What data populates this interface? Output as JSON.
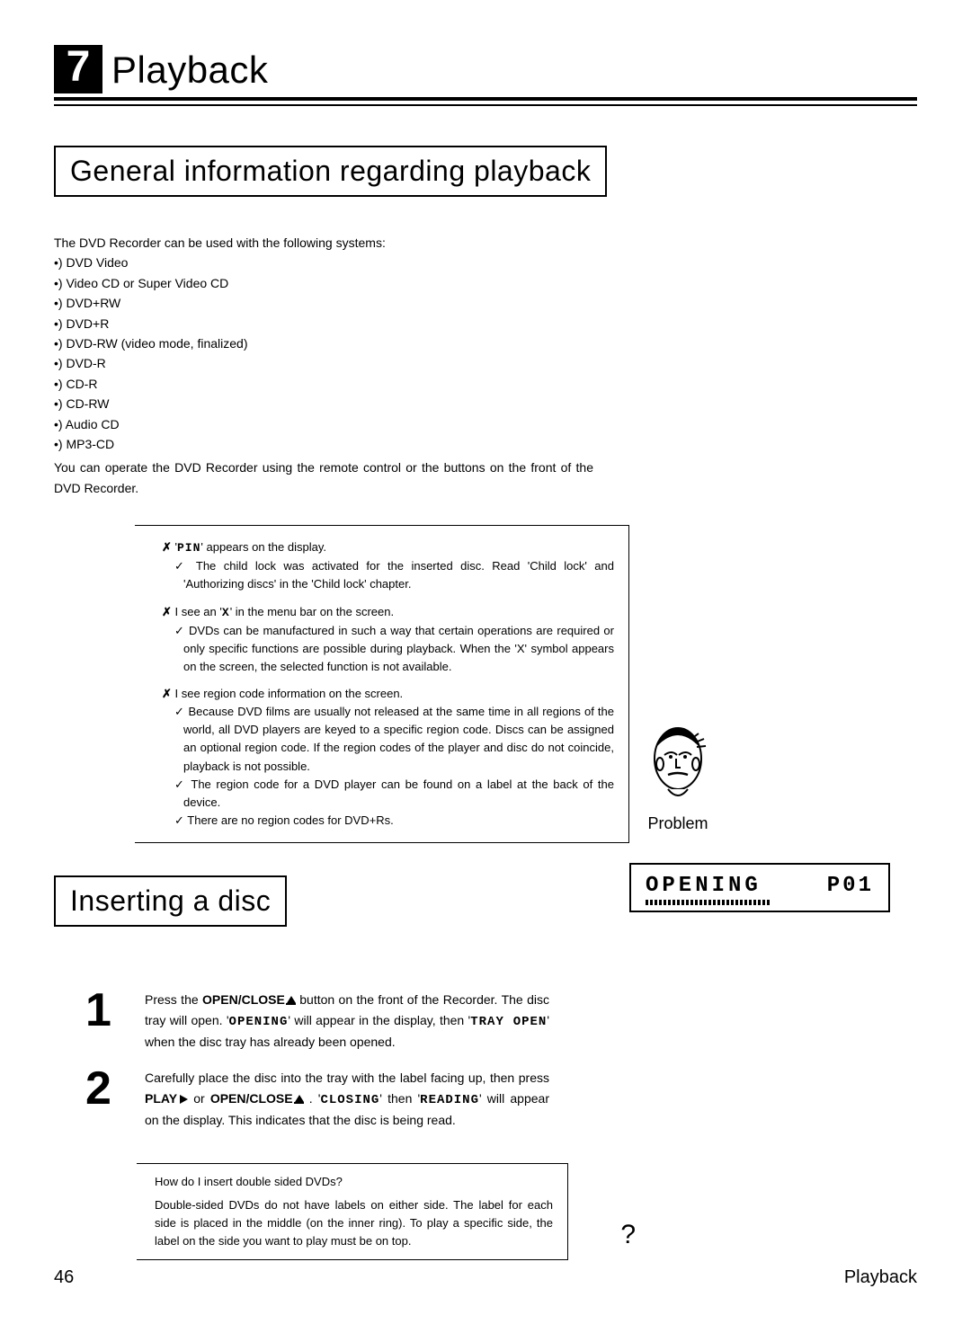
{
  "chapter": {
    "number": "7",
    "title": "Playback"
  },
  "section1_heading": "General information regarding playback",
  "intro_line": "The DVD Recorder can be used with the following systems:",
  "systems": [
    "DVD Video",
    "Video CD or Super Video CD",
    "DVD+RW",
    "DVD+R",
    "DVD-RW (video mode, finalized)",
    "DVD-R",
    "CD-R",
    "CD-RW",
    "Audio CD",
    "MP3-CD"
  ],
  "intro_note": "You can operate the DVD Recorder using the remote control or the buttons on the front of the DVD Recorder.",
  "problem": {
    "label": "Problem",
    "items": [
      {
        "q_pre": "'",
        "q_code": "PIN",
        "q_post": "' appears on the display.",
        "answers": [
          "The child lock was activated for the inserted disc. Read 'Child lock' and 'Authorizing discs' in the 'Child lock' chapter."
        ]
      },
      {
        "q_pre": "I see an '",
        "q_code": "X",
        "q_post": "' in the menu bar on the screen.",
        "answers": [
          "DVDs can be manufactured in such a way that certain operations are required or only specific functions are possible during playback. When the 'X' symbol appears on the screen, the selected function is not available."
        ]
      },
      {
        "q_pre": "I see region code information on the screen.",
        "q_code": "",
        "q_post": "",
        "answers": [
          "Because DVD films are usually not released at the same time in all regions of the world, all DVD players are keyed to a specific region code. Discs can be assigned an optional region code. If the region codes of the player and disc do not coincide, playback is not possible.",
          "The region code for a DVD player can be found on a label at the back of the device.",
          "There are no region codes for DVD+Rs."
        ]
      }
    ]
  },
  "section2_heading": "Inserting a disc",
  "steps": [
    {
      "num": "1",
      "pre": "Press the ",
      "btn1": "OPEN/CLOSE",
      "mid1": " button on the front of the Recorder. The disc tray will open. '",
      "code1": "OPENING",
      "mid2": "' will appear in the display, then '",
      "code2": "TRAY OPEN",
      "post": "' when the disc tray has already been opened."
    },
    {
      "num": "2",
      "pre": "Carefully place the disc into the tray with the label facing up, then press ",
      "btn1": "PLAY",
      "mid1": " or ",
      "btn2": "OPEN/CLOSE",
      "mid2": " . '",
      "code1": "CLOSING",
      "mid3": "' then '",
      "code2": "READING",
      "post": "' will appear on the display. This indicates that the disc is being read."
    }
  ],
  "display": {
    "main": "OPENING",
    "side": "P01"
  },
  "faq": {
    "q": "How do I insert double sided DVDs?",
    "a": "Double-sided DVDs do not have labels on either side. The label for each side is placed in the middle (on the inner ring). To play a specific side, the label on the side you want to play must be on top.",
    "mark": "?"
  },
  "footer": {
    "page": "46",
    "title": "Playback"
  }
}
